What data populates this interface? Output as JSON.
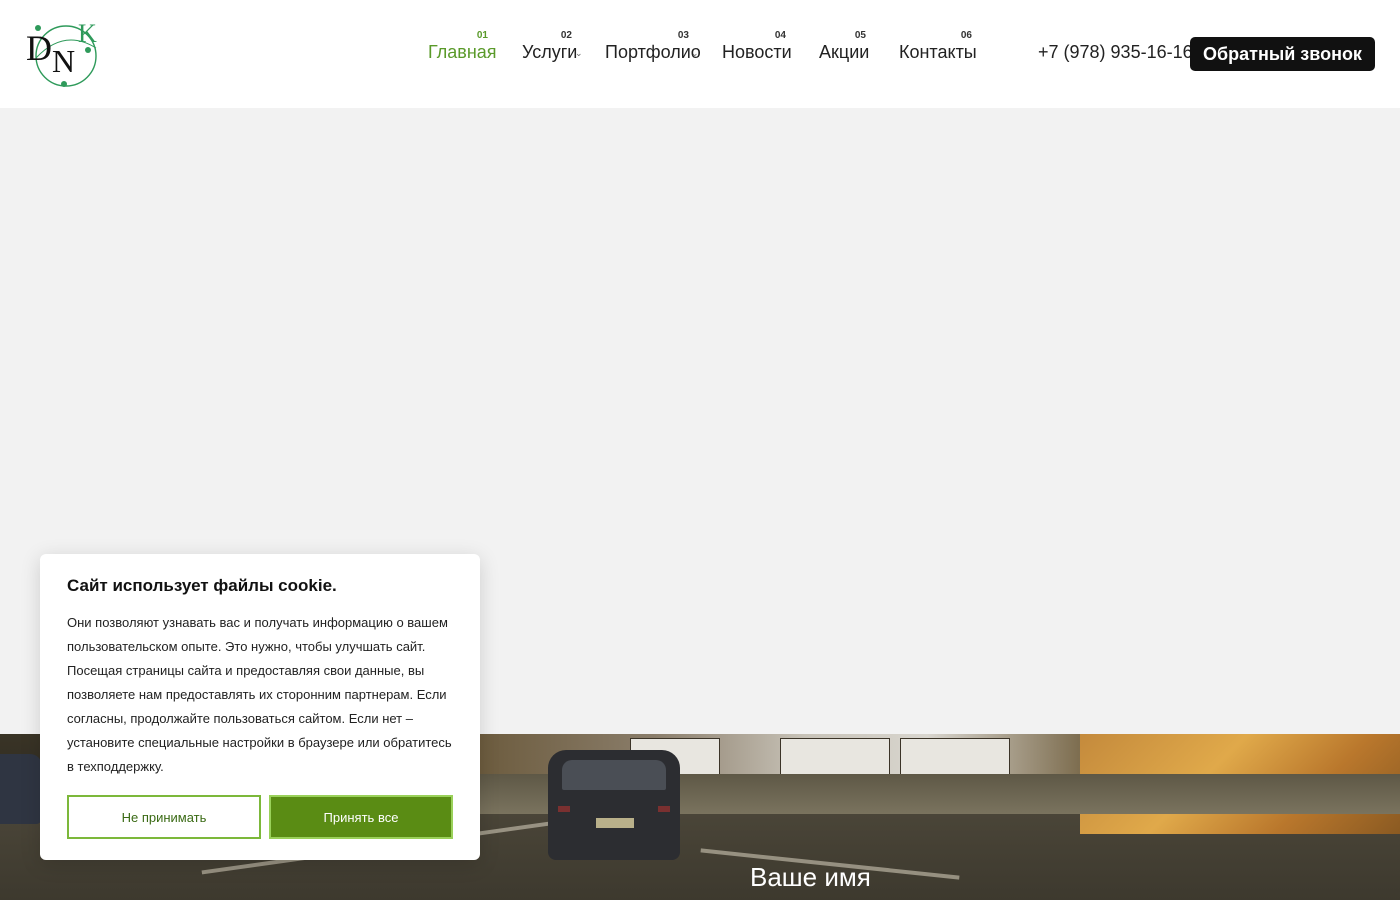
{
  "header": {
    "nav": [
      {
        "num": "01",
        "label": "Главная",
        "active": true
      },
      {
        "num": "02",
        "label": "Услуги",
        "has_dropdown": true
      },
      {
        "num": "03",
        "label": "Портфолио",
        "has_dropdown": true
      },
      {
        "num": "04",
        "label": "Новости"
      },
      {
        "num": "05",
        "label": "Акции"
      },
      {
        "num": "06",
        "label": "Контакты"
      }
    ],
    "phone": "+7 (978) 935-16-16",
    "callback_button": "Обратный звонок"
  },
  "form": {
    "name_label": "Ваше имя"
  },
  "cookie": {
    "title": "Сайт использует файлы cookie.",
    "text": "Они позволяют узнавать вас и получать информацию о вашем пользовательском опыте. Это нужно, чтобы улучшать сайт. Посещая страницы сайта и предоставляя свои данные, вы позволяете нам предоставлять их сторонним партнерам. Если согласны, продолжайте пользоваться сайтом. Если нет – установите специальные настройки в браузере или обратитесь в техподдержку.",
    "decline_button": "Не принимать",
    "accept_button": "Принять все"
  },
  "colors": {
    "accent_green": "#5a9a2a",
    "button_dark": "#111111",
    "accept_green": "#5a8c14",
    "decline_border": "#7cb83a"
  },
  "icons": {
    "dropdown": "chevron-down-icon",
    "logo": "dnk-logo"
  }
}
